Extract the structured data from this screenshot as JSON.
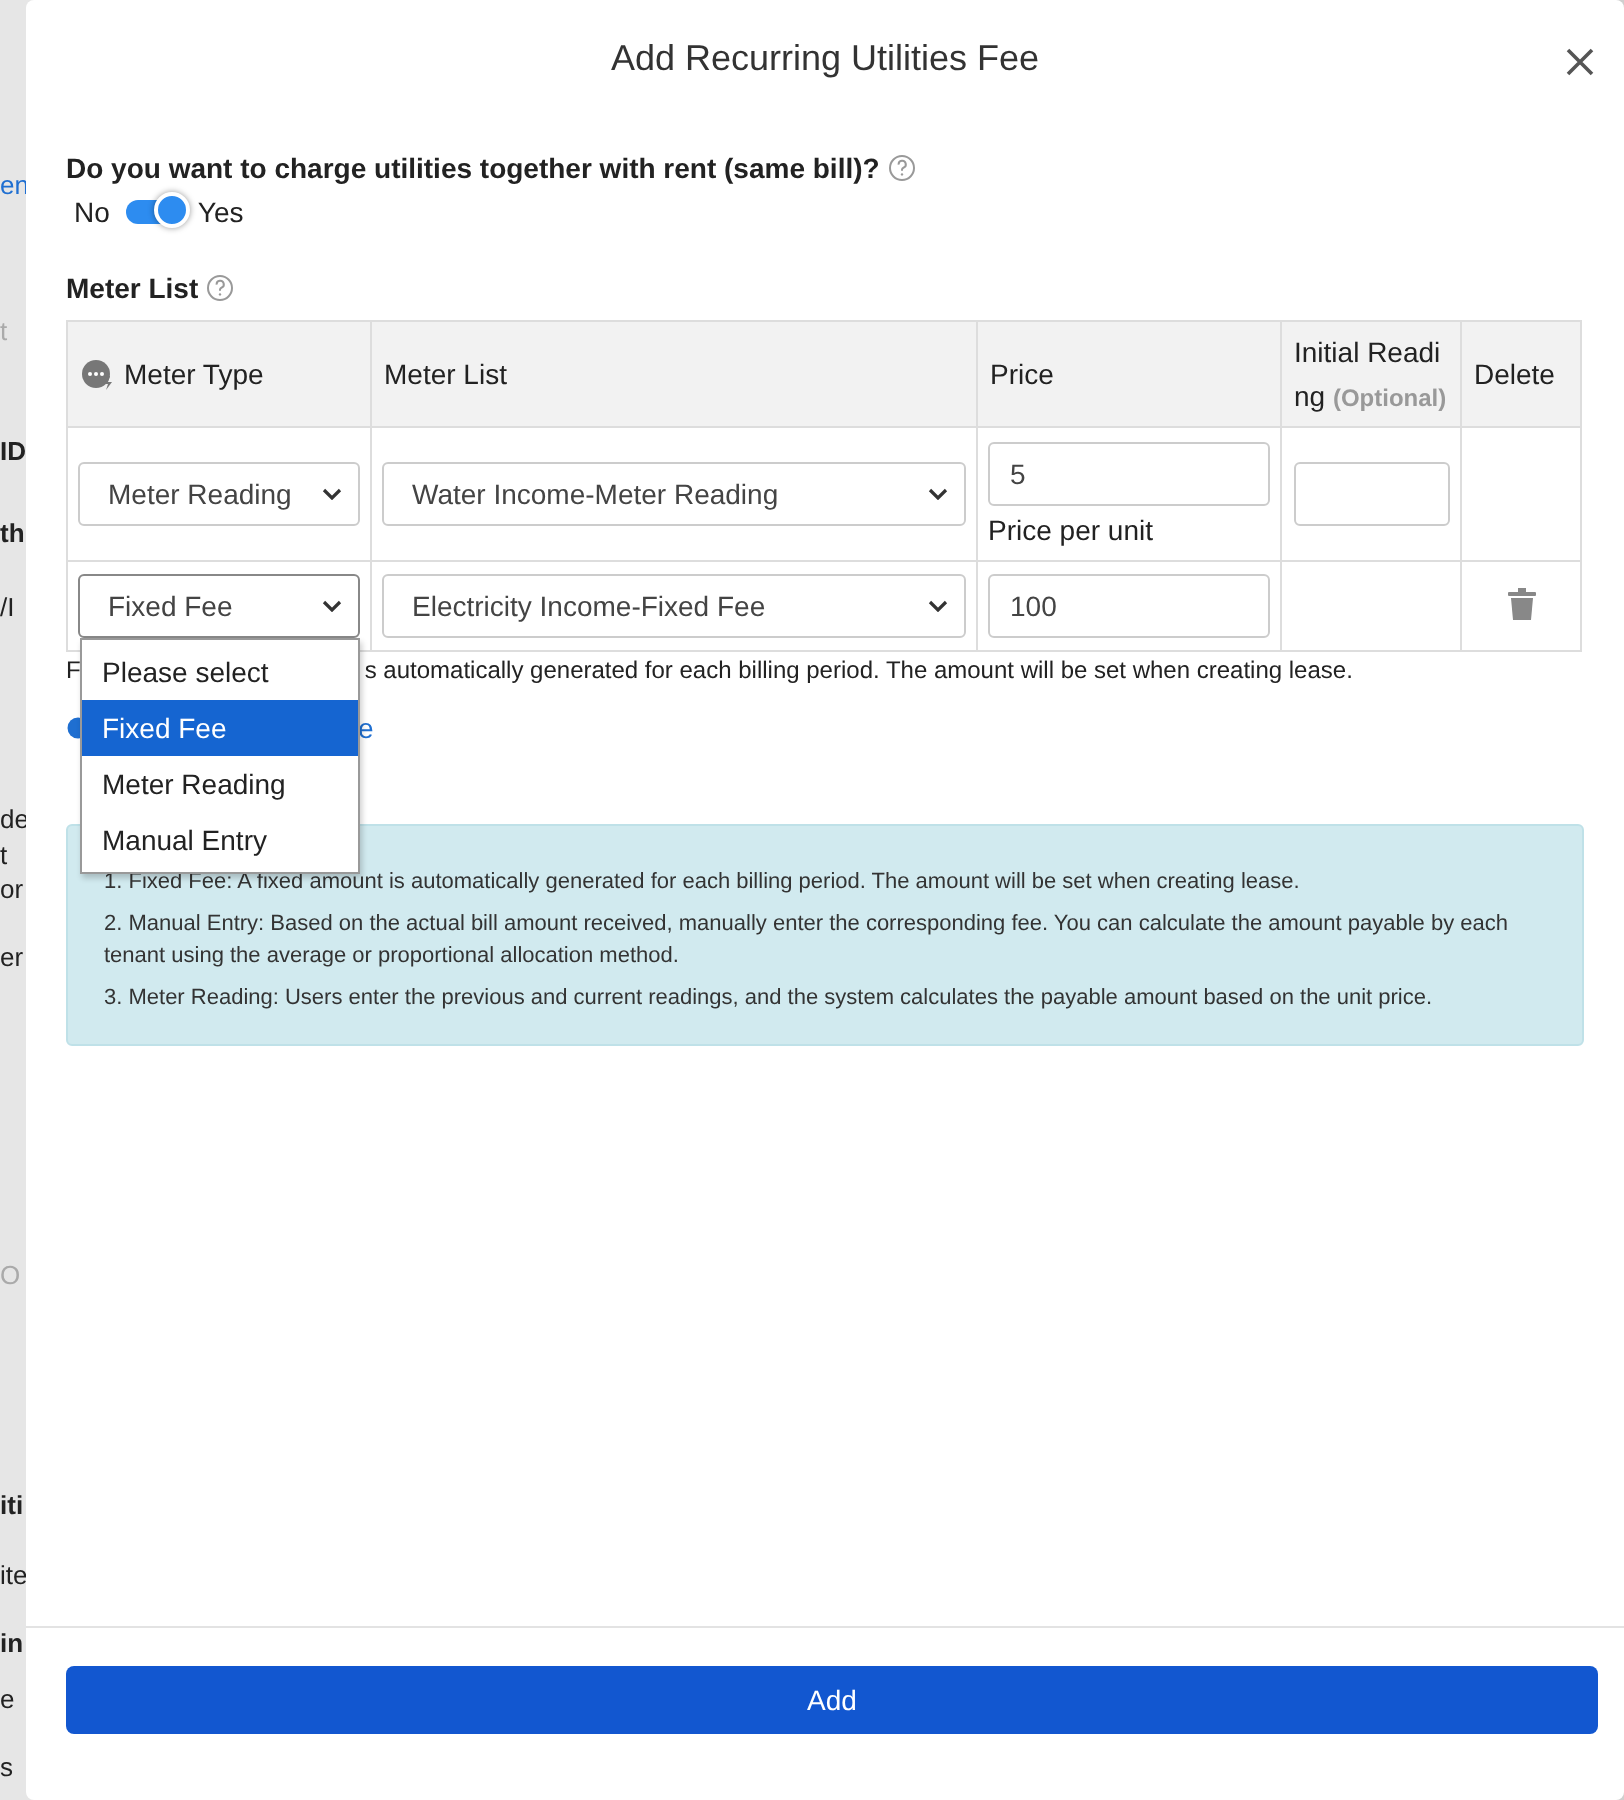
{
  "backdrop": {
    "fragments": [
      {
        "text": "en",
        "kind": "link"
      },
      {
        "text": "t",
        "kind": "muted"
      },
      {
        "text": "ID",
        "kind": "bold"
      },
      {
        "text": "th",
        "kind": "bold"
      },
      {
        "text": "/I",
        "kind": "plain"
      },
      {
        "text": "de",
        "kind": "plain"
      },
      {
        "text": "t",
        "kind": "plain"
      },
      {
        "text": "or",
        "kind": "plain"
      },
      {
        "text": "er",
        "kind": "plain"
      },
      {
        "text": "O",
        "kind": "muted"
      },
      {
        "text": "iti",
        "kind": "bold"
      },
      {
        "text": "ite",
        "kind": "plain"
      },
      {
        "text": "in",
        "kind": "bold"
      },
      {
        "text": "e",
        "kind": "plain"
      },
      {
        "text": "s",
        "kind": "plain"
      }
    ]
  },
  "modal": {
    "title": "Add Recurring Utilities Fee"
  },
  "question": {
    "text": "Do you want to charge utilities together with rent (same bill)?"
  },
  "toggle": {
    "off_label": "No",
    "on_label": "Yes",
    "on": true
  },
  "meter_section": {
    "title": "Meter List"
  },
  "table": {
    "columns": [
      {
        "label": "Meter Type",
        "kind": "icon"
      },
      {
        "label": "Meter List",
        "kind": "plain"
      },
      {
        "label": "Price",
        "kind": "plain"
      },
      {
        "label": "Initial Reading",
        "note": "(Optional)",
        "kind": "note"
      },
      {
        "label": "Delete",
        "kind": "plain"
      }
    ],
    "rows": [
      {
        "meter_type": "Meter Reading",
        "meter": "Water Income-Meter Reading",
        "price": "5",
        "price_note": "Price per unit",
        "kind": "reading",
        "deletable": false,
        "menu_open": false
      },
      {
        "meter_type": "Fixed Fee",
        "meter": "Electricity Income-Fixed Fee",
        "price": "100",
        "kind": "fixed",
        "deletable": true,
        "menu_open": true
      }
    ]
  },
  "dropdown": {
    "options": [
      {
        "label": "Please select",
        "selected": false
      },
      {
        "label": "Fixed Fee",
        "selected": true
      },
      {
        "label": "Meter Reading",
        "selected": false
      },
      {
        "label": "Manual Entry",
        "selected": false
      }
    ]
  },
  "hint": {
    "before": "F",
    "after": "s automatically generated for each billing period. The amount will be set when creating lease."
  },
  "add_link": {
    "label": "e"
  },
  "info": {
    "lines": [
      "1. Fixed Fee: A fixed amount is automatically generated for each billing period. The amount will be set when creating lease.",
      "2. Manual Entry: Based on the actual bill amount received, manually enter the corresponding fee. You can calculate the amount payable by each tenant using the average or proportional allocation method.",
      "3. Meter Reading: Users enter the previous and current readings, and the system calculates the payable amount based on the unit price."
    ]
  },
  "footer": {
    "button": "Add"
  }
}
